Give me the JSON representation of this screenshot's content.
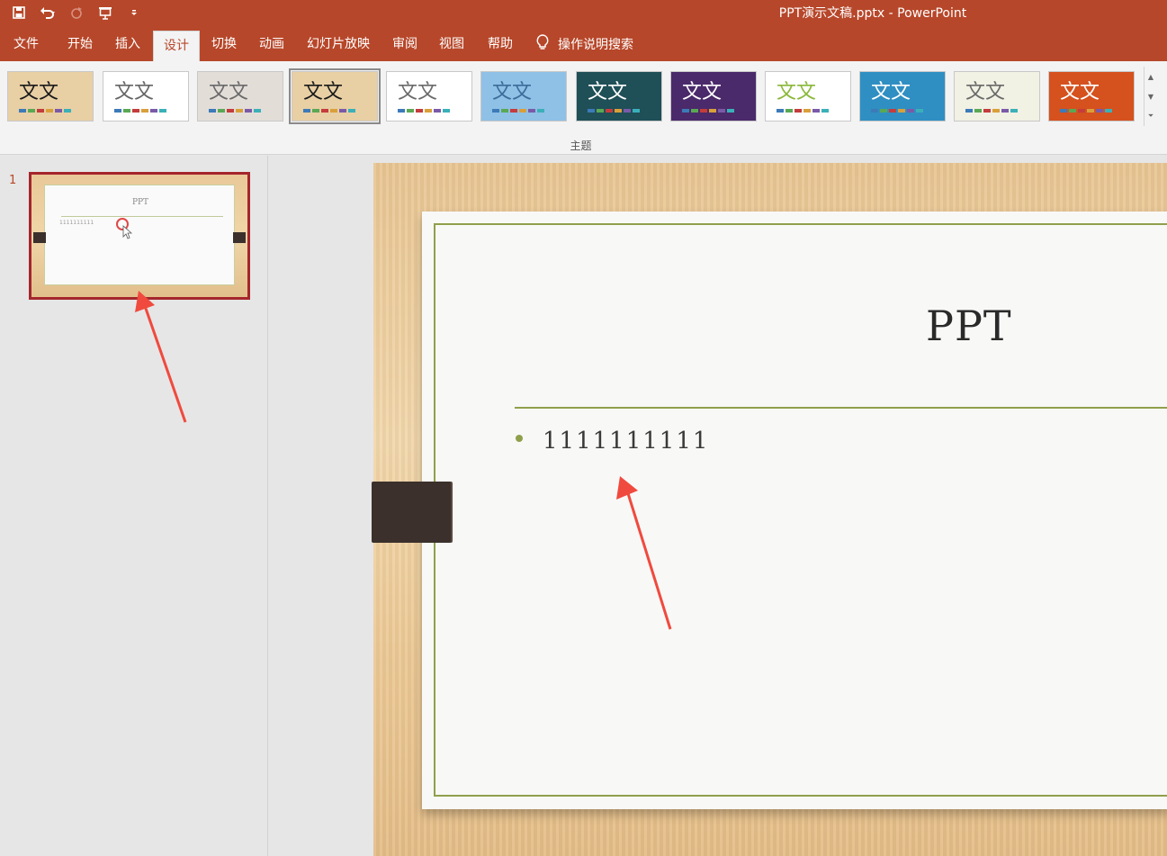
{
  "window_title": "PPT演示文稿.pptx  -  PowerPoint",
  "qat": {
    "items": [
      {
        "name": "save-icon"
      },
      {
        "name": "undo-icon"
      },
      {
        "name": "redo-icon"
      },
      {
        "name": "presentation-icon"
      },
      {
        "name": "customize-qat-icon"
      }
    ]
  },
  "tabs": [
    {
      "label": "文件"
    },
    {
      "label": "开始"
    },
    {
      "label": "插入"
    },
    {
      "label": "设计",
      "active": true
    },
    {
      "label": "切换"
    },
    {
      "label": "动画"
    },
    {
      "label": "幻灯片放映"
    },
    {
      "label": "审阅"
    },
    {
      "label": "视图"
    },
    {
      "label": "帮助"
    }
  ],
  "tell_me": {
    "label": "操作说明搜索",
    "icon": "lightbulb-icon"
  },
  "ribbon": {
    "group_label": "主题",
    "themes": [
      {
        "text": "文文",
        "bg": "#e8cfa4",
        "fg": "#1a1a1a",
        "selected": false
      },
      {
        "text": "文文",
        "bg": "#ffffff",
        "fg": "#666666",
        "selected": false
      },
      {
        "text": "文文",
        "bg": "#e3ddd8",
        "fg": "#6a6a6a",
        "selected": false
      },
      {
        "text": "文文",
        "bg": "#e8cfa4",
        "fg": "#1a1a1a",
        "selected": true
      },
      {
        "text": "文文",
        "bg": "#ffffff",
        "fg": "#6a6a6a",
        "selected": false
      },
      {
        "text": "文文",
        "bg": "#8fc0e6",
        "fg": "#3b6c9a",
        "selected": false
      },
      {
        "text": "文文",
        "bg": "#1f4f57",
        "fg": "#ffffff",
        "selected": false
      },
      {
        "text": "文文",
        "bg": "#4a2a6a",
        "fg": "#ffffff",
        "selected": false
      },
      {
        "text": "文文",
        "bg": "#ffffff",
        "fg": "#8ab83a",
        "selected": false
      },
      {
        "text": "文文",
        "bg": "#2f8fc2",
        "fg": "#ffffff",
        "selected": false
      },
      {
        "text": "文文",
        "bg": "#f1f1e4",
        "fg": "#6a6a6a",
        "selected": false
      },
      {
        "text": "文文",
        "bg": "#d5511e",
        "fg": "#ffffff",
        "selected": false
      }
    ]
  },
  "slides": [
    {
      "number": "1",
      "title": "PPT",
      "bullet": "1111111111"
    }
  ],
  "slide": {
    "title": "PPT",
    "bullet": "1111111111"
  },
  "colors": {
    "accent": "#b7472a",
    "rule": "#8fa04b",
    "annotation_arrow": "#f04a3e"
  }
}
